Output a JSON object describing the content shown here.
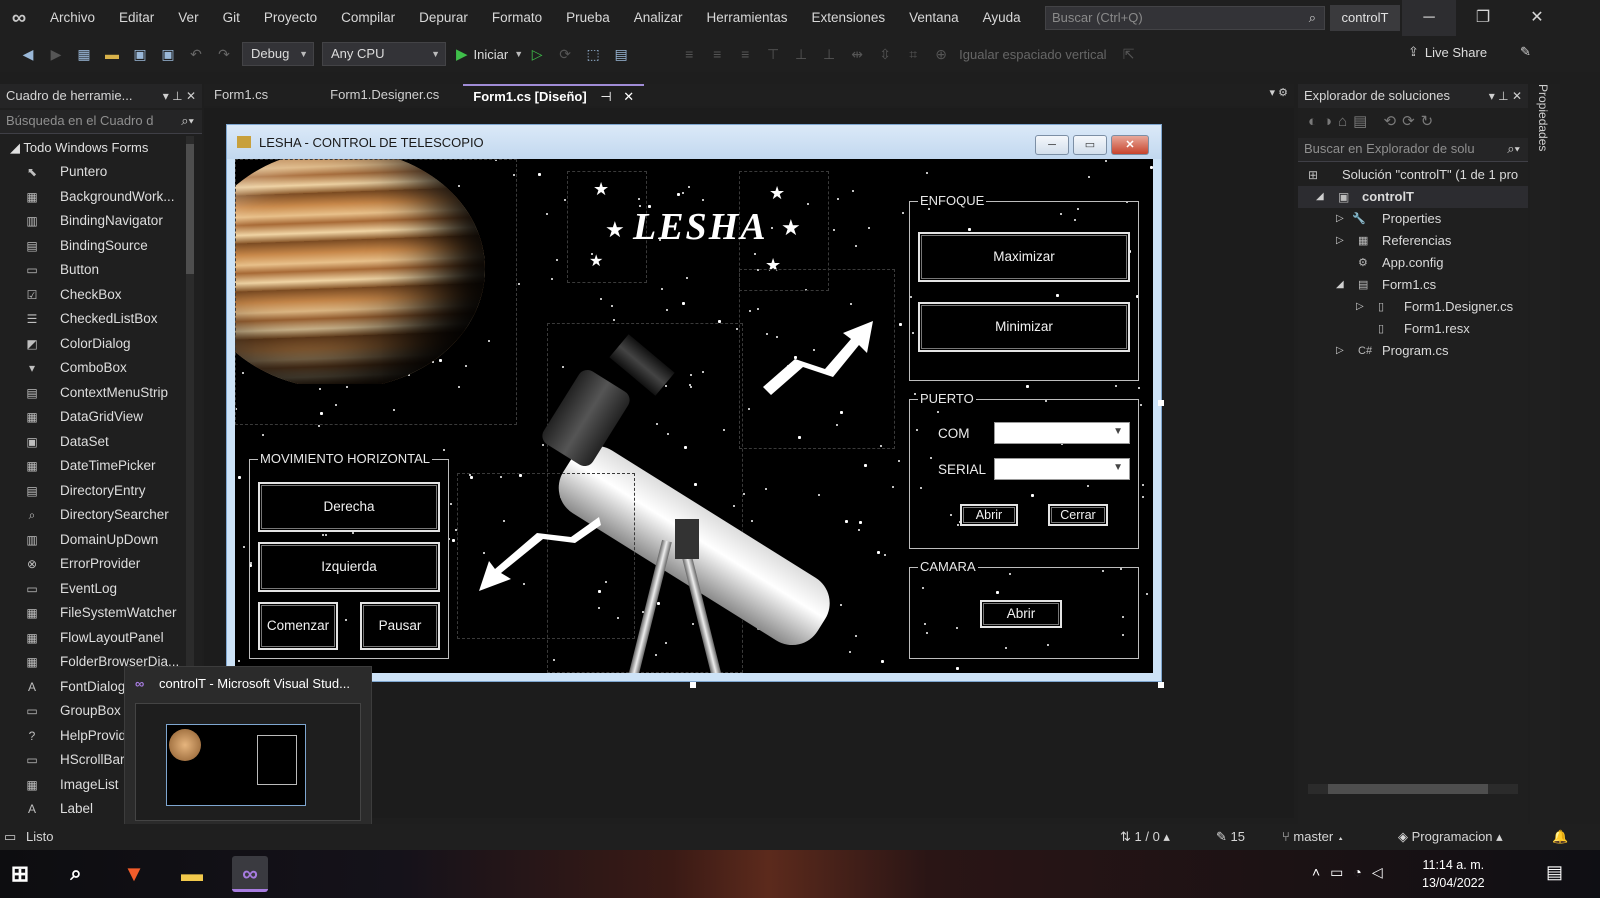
{
  "menubar": {
    "items": [
      "Archivo",
      "Editar",
      "Ver",
      "Git",
      "Proyecto",
      "Compilar",
      "Depurar",
      "Formato",
      "Prueba",
      "Analizar",
      "Herramientas",
      "Extensiones",
      "Ventana",
      "Ayuda"
    ],
    "search_placeholder": "Buscar (Ctrl+Q)",
    "project_name": "controlT"
  },
  "toolbar": {
    "config": "Debug",
    "platform": "Any CPU",
    "start_label": "Iniciar",
    "spacing_label": "Igualar espaciado vertical",
    "live_share": "Live Share"
  },
  "toolbox": {
    "title": "Cuadro de herramie...",
    "search_placeholder": "Búsqueda en el Cuadro d",
    "group": "Todo Windows Forms",
    "items": [
      "Puntero",
      "BackgroundWork...",
      "BindingNavigator",
      "BindingSource",
      "Button",
      "CheckBox",
      "CheckedListBox",
      "ColorDialog",
      "ComboBox",
      "ContextMenuStrip",
      "DataGridView",
      "DataSet",
      "DateTimePicker",
      "DirectoryEntry",
      "DirectorySearcher",
      "DomainUpDown",
      "ErrorProvider",
      "EventLog",
      "FileSystemWatcher",
      "FlowLayoutPanel",
      "FolderBrowserDia...",
      "FontDialog",
      "GroupBox",
      "HelpProvider",
      "HScrollBar",
      "ImageList",
      "Label"
    ]
  },
  "tabs": [
    {
      "label": "Form1.cs"
    },
    {
      "label": "Form1.Designer.cs"
    },
    {
      "label": "Form1.cs [Diseño]"
    }
  ],
  "form": {
    "title": "LESHA - CONTROL DE TELESCOPIO",
    "logo_text": "LESHA",
    "enfoque": {
      "title": "ENFOQUE",
      "max": "Maximizar",
      "min": "Minimizar"
    },
    "puerto": {
      "title": "PUERTO",
      "com": "COM",
      "serial": "SERIAL",
      "abrir": "Abrir",
      "cerrar": "Cerrar"
    },
    "camara": {
      "title": "CAMARA",
      "abrir": "Abrir"
    },
    "movimiento": {
      "title": "MOVIMIENTO HORIZONTAL",
      "derecha": "Derecha",
      "izquierda": "Izquierda",
      "comenzar": "Comenzar",
      "pausar": "Pausar"
    }
  },
  "solution": {
    "title": "Explorador de soluciones",
    "search_placeholder": "Buscar en Explorador de solu",
    "solution_label": "Solución \"controlT\" (1 de 1 pro",
    "project": "controlT",
    "nodes": [
      "Properties",
      "Referencias",
      "App.config",
      "Form1.cs",
      "Form1.Designer.cs",
      "Form1.resx",
      "Program.cs"
    ]
  },
  "properties_label": "Propiedades",
  "thumbnail_title": "controlT - Microsoft Visual Stud...",
  "status": {
    "ready": "Listo",
    "changes": "1 / 0",
    "edits": "15",
    "branch": "master",
    "repo": "Programacion"
  },
  "taskbar": {
    "time": "11:14 a. m.",
    "date": "13/04/2022"
  }
}
